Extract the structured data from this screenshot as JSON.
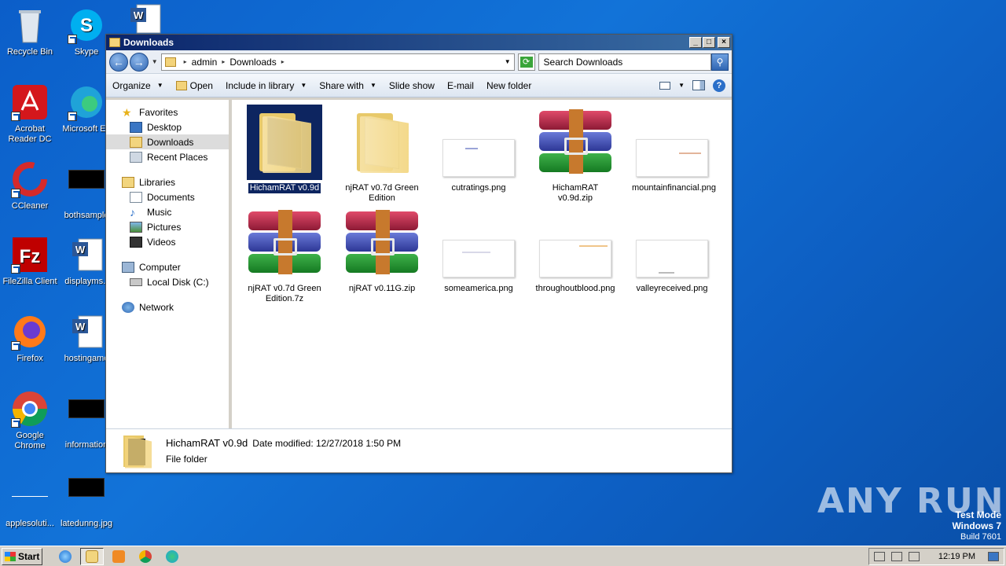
{
  "desktop": {
    "icons": [
      {
        "label": "Recycle Bin"
      },
      {
        "label": "Skype"
      },
      {
        "label": "Acrobat Reader DC"
      },
      {
        "label": "Microsoft Ed"
      },
      {
        "label": "CCleaner"
      },
      {
        "label": "bothsample"
      },
      {
        "label": "FileZilla Client"
      },
      {
        "label": "displayms.r"
      },
      {
        "label": "Firefox"
      },
      {
        "label": "hostingamo"
      },
      {
        "label": "Google Chrome"
      },
      {
        "label": "information"
      },
      {
        "label": "applesoluti..."
      },
      {
        "label": "latedunng.jpg"
      }
    ]
  },
  "window": {
    "title": "Downloads",
    "breadcrumb": [
      "admin",
      "Downloads"
    ],
    "search_placeholder": "Search Downloads",
    "toolbar": {
      "organize": "Organize",
      "open": "Open",
      "include": "Include in library",
      "share": "Share with",
      "slideshow": "Slide show",
      "email": "E-mail",
      "newfolder": "New folder"
    },
    "nav": {
      "favorites": "Favorites",
      "desktop": "Desktop",
      "downloads": "Downloads",
      "recent": "Recent Places",
      "libraries": "Libraries",
      "documents": "Documents",
      "music": "Music",
      "pictures": "Pictures",
      "videos": "Videos",
      "computer": "Computer",
      "localdisk": "Local Disk (C:)",
      "network": "Network"
    },
    "files": [
      {
        "name": "HichamRAT v0.9d",
        "type": "folder-dark"
      },
      {
        "name": "njRAT v0.7d Green Edition",
        "type": "folder"
      },
      {
        "name": "cutratings.png",
        "type": "png"
      },
      {
        "name": "HichamRAT v0.9d.zip",
        "type": "rar"
      },
      {
        "name": "mountainfinancial.png",
        "type": "png"
      },
      {
        "name": "njRAT v0.7d Green Edition.7z",
        "type": "rar"
      },
      {
        "name": "njRAT v0.11G.zip",
        "type": "rar"
      },
      {
        "name": "someamerica.png",
        "type": "png"
      },
      {
        "name": "throughoutblood.png",
        "type": "png"
      },
      {
        "name": "valleyreceived.png",
        "type": "png"
      }
    ],
    "details": {
      "name": "HichamRAT v0.9d",
      "modified": "Date modified: 12/27/2018 1:50 PM",
      "type": "File folder"
    }
  },
  "taskbar": {
    "start": "Start",
    "clock": "12:19 PM"
  },
  "watermark": {
    "line1": "Test Mode",
    "line2": "Windows 7",
    "line3": "Build 7601",
    "brand": "ANY RUN"
  }
}
